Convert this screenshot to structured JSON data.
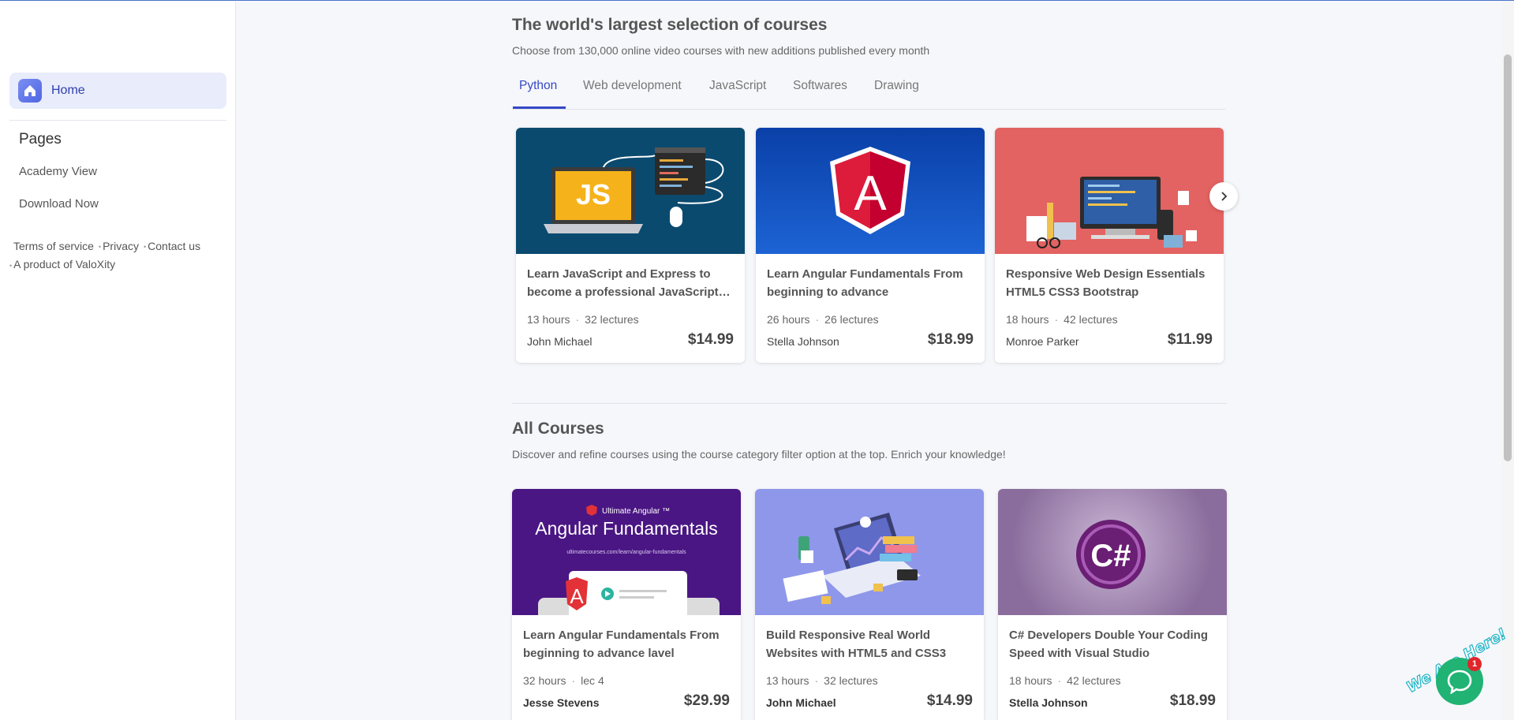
{
  "sidebar": {
    "home_label": "Home",
    "pages_heading": "Pages",
    "pages": [
      "Academy View",
      "Download Now"
    ],
    "footer": {
      "terms": "Terms of service",
      "privacy": "Privacy",
      "contact": "Contact us",
      "product": "A product of ValoXity"
    }
  },
  "section1": {
    "title": "The world's largest selection of courses",
    "subtitle": "Choose from 130,000 online video courses with new additions published every month",
    "tabs": [
      "Python",
      "Web development",
      "JavaScript",
      "Softwares",
      "Drawing"
    ],
    "active_tab": "Python",
    "courses": [
      {
        "title": "Learn JavaScript and Express to become a professional JavaScript developer",
        "hours": "13 hours",
        "lectures": "32 lectures",
        "author": "John Michael",
        "price": "$14.99",
        "thumb_text": "JS"
      },
      {
        "title": "Learn Angular Fundamentals From beginning to advance",
        "hours": "26 hours",
        "lectures": "26 lectures",
        "author": "Stella Johnson",
        "price": "$18.99",
        "thumb_text": "A"
      },
      {
        "title": "Responsive Web Design Essentials HTML5 CSS3 Bootstrap",
        "hours": "18 hours",
        "lectures": "42 lectures",
        "author": "Monroe Parker",
        "price": "$11.99"
      }
    ]
  },
  "section2": {
    "title": "All Courses",
    "subtitle": "Discover and refine courses using the course category filter option at the top. Enrich your knowledge!",
    "courses": [
      {
        "title": "Learn Angular Fundamentals From beginning to advance lavel",
        "hours": "32 hours",
        "lectures": "lec 4",
        "author": "Jesse Stevens",
        "price": "$29.99",
        "thumb_brand": "Ultimate Angular ™",
        "thumb_title": "Angular Fundamentals",
        "thumb_url": "ultimatecourses.com/learn/angular-fundamentals",
        "thumb_logo": "A"
      },
      {
        "title": "Build Responsive Real World Websites with HTML5 and CSS3",
        "hours": "13 hours",
        "lectures": "32 lectures",
        "author": "John Michael",
        "price": "$14.99"
      },
      {
        "title": "C# Developers Double Your Coding Speed with Visual Studio",
        "hours": "18 hours",
        "lectures": "42 lectures",
        "author": "Stella Johnson",
        "price": "$18.99",
        "thumb_text": "C#"
      }
    ]
  },
  "chat": {
    "text": "We Are Here!",
    "badge": "1"
  },
  "colors": {
    "accent": "#3448c5",
    "chat": "#20b374",
    "badge": "#e0262b"
  }
}
